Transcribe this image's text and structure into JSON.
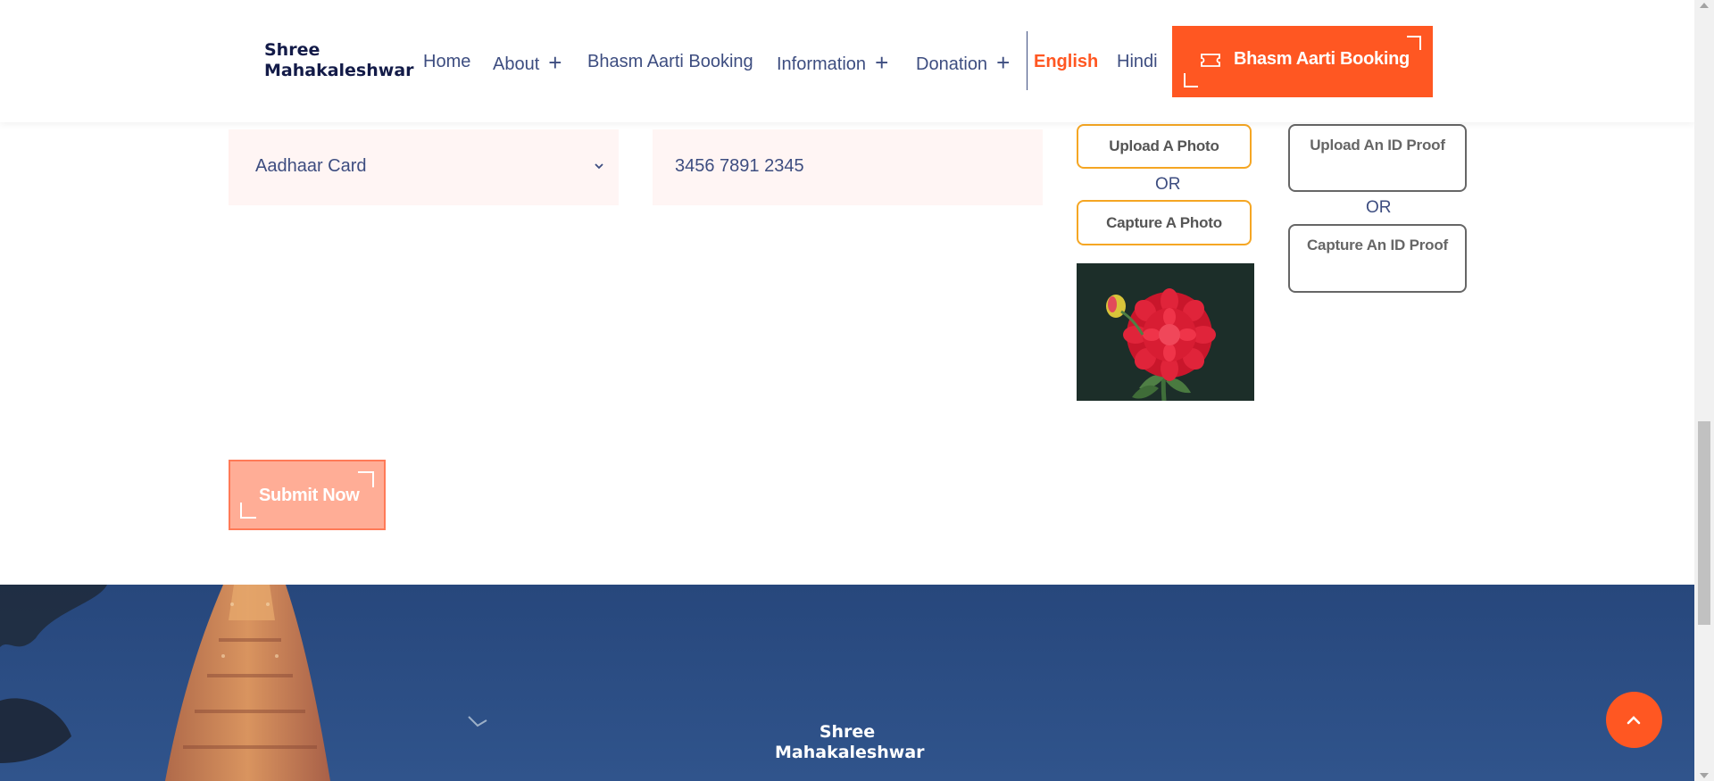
{
  "header": {
    "logo_line1": "Shree",
    "logo_line2": "Mahakaleshwar",
    "nav": [
      {
        "label": "Home",
        "has_submenu": false
      },
      {
        "label": "About",
        "has_submenu": true
      },
      {
        "label": "Bhasm Aarti Booking",
        "has_submenu": false
      },
      {
        "label": "Information",
        "has_submenu": true
      },
      {
        "label": "Donation",
        "has_submenu": true
      }
    ],
    "submenu_icon": "+",
    "lang_english": "English",
    "lang_hindi": "Hindi",
    "cta_label": "Bhasm Aarti Booking",
    "cta_icon": "ticket-icon"
  },
  "form": {
    "id_type_value": "Aadhaar Card",
    "id_number_value": "3456 7891 2345",
    "upload_photo_label": "Upload A Photo",
    "or_label": "OR",
    "capture_photo_label": "Capture A Photo",
    "upload_id_label": "Upload An ID Proof",
    "capture_id_label": "Capture An ID Proof",
    "submit_label": "Submit Now"
  },
  "footer": {
    "logo_line1": "Shree",
    "logo_line2": "Mahakaleshwar"
  },
  "colors": {
    "accent": "#ff5722",
    "nav_text": "#3d4d80",
    "field_bg": "#fff5f4",
    "photo_btn_border": "#f5a623",
    "footer_bg": "#2b4f86"
  }
}
